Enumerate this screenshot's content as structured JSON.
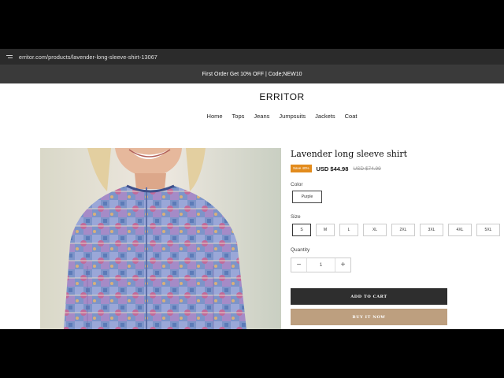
{
  "browser": {
    "url": "erritor.com/products/lavender-long-sleeve-shirt-13067",
    "url_icon": "tune-icon"
  },
  "announcement": "First Order Get 10% OFF | Code;NEW10",
  "header": {
    "logo": "ERRITOR",
    "nav": [
      "Home",
      "Tops",
      "Jeans",
      "Jumpsuits",
      "Jackets",
      "Coat"
    ]
  },
  "product": {
    "title": "Lavender long sleeve shirt",
    "badge": "Save 40%",
    "price": "USD $44.98",
    "compare_price": "USD $74.99",
    "color_label": "Color",
    "color_selected": "Purple",
    "size_label": "Size",
    "sizes": [
      "S",
      "M",
      "L",
      "XL",
      "2XL",
      "3XL",
      "4XL",
      "5XL"
    ],
    "selected_size": "S",
    "quantity_label": "Quantity",
    "quantity": "1",
    "minus": "−",
    "plus": "+",
    "add_to_cart": "ADD TO CART",
    "buy_now": "BUY IT NOW"
  },
  "colors": {
    "badge": "#e28b1d",
    "cart_button": "#2e2e2e",
    "buy_button": "#bd9f7f"
  }
}
